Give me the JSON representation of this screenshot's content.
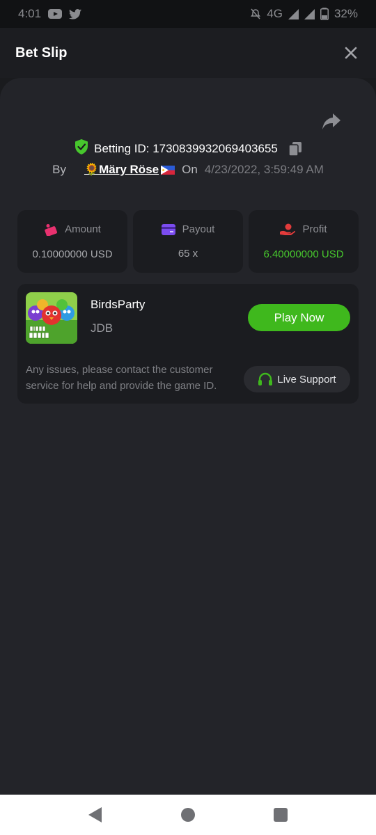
{
  "status_bar": {
    "time": "4:01",
    "network": "4G",
    "battery": "32%"
  },
  "header": {
    "title": "Bet Slip"
  },
  "bet": {
    "id_label": "Betting ID: 1730839932069403655",
    "by_label": "By",
    "user_name": "🌻Märy Röse",
    "on_label": "On",
    "date": "4/23/2022, 3:59:49 AM"
  },
  "stats": [
    {
      "label": "Amount",
      "value": "0.10000000 USD",
      "icon": "amount-icon"
    },
    {
      "label": "Payout",
      "value": "65 x",
      "icon": "payout-icon"
    },
    {
      "label": "Profit",
      "value": "6.40000000 USD",
      "icon": "profit-icon"
    }
  ],
  "game": {
    "name": "BirdsParty",
    "provider": "JDB",
    "play_label": "Play Now",
    "issues_text": "Any issues, please contact the customer service for help and provide the game ID.",
    "support_label": "Live Support"
  },
  "colors": {
    "accent_green": "#3fb81d",
    "profit_green": "#47c72d",
    "panel": "#232429",
    "card": "#1b1c20"
  }
}
